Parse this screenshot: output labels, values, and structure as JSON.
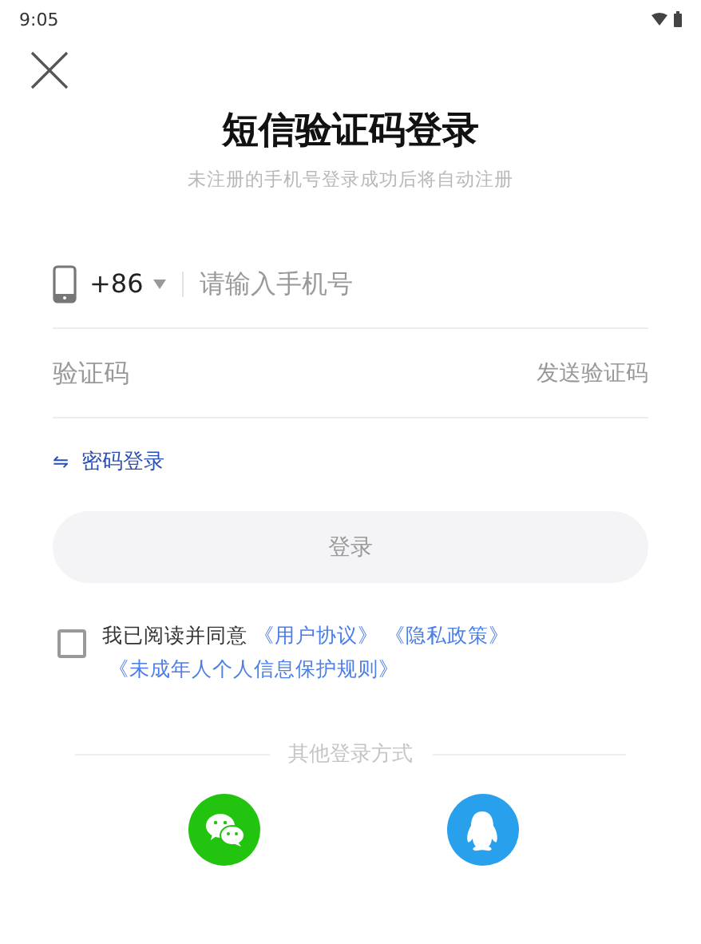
{
  "status_bar": {
    "time": "9:05"
  },
  "title": "短信验证码登录",
  "subtitle": "未注册的手机号登录成功后将自动注册",
  "phone_field": {
    "country_code": "+86",
    "placeholder": "请输入手机号"
  },
  "code_field": {
    "placeholder": "验证码",
    "action": "发送验证码"
  },
  "switch_link": {
    "icon": "⇋",
    "label": "密码登录"
  },
  "login_button": {
    "label": "登录",
    "disabled": true
  },
  "agreement": {
    "checked": false,
    "text": "我已阅读并同意",
    "links": [
      "《用户协议》",
      "《隐私政策》",
      "《未成年人个人信息保护规则》"
    ]
  },
  "other_login": {
    "label": "其他登录方式",
    "options": [
      {
        "kind": "wechat",
        "color": "#22c40f"
      },
      {
        "kind": "qq",
        "color": "#28a0ec"
      }
    ]
  }
}
